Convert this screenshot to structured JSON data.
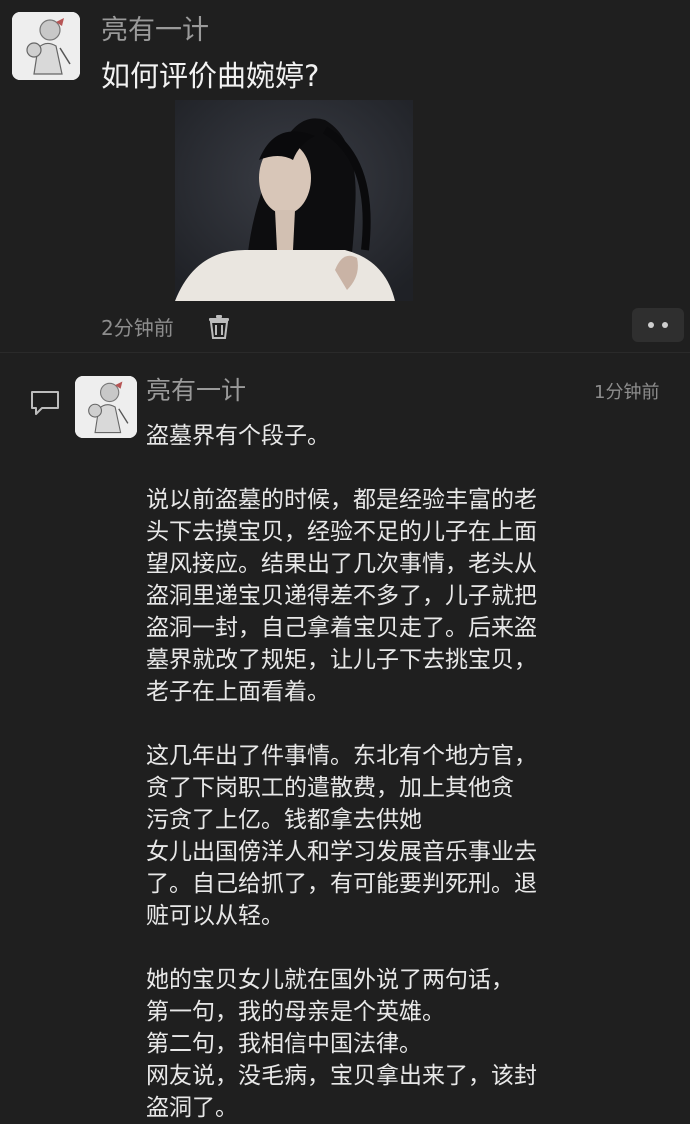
{
  "post": {
    "author": "亮有一计",
    "title": "如何评价曲婉婷?",
    "time": "2分钟前"
  },
  "comment": {
    "author": "亮有一计",
    "time": "1分钟前",
    "lines": [
      "盗墓界有个段子。",
      "",
      "说以前盗墓的时候，都是经验丰富的老",
      "头下去摸宝贝，经验不足的儿子在上面",
      "望风接应。结果出了几次事情，老头从",
      "盗洞里递宝贝递得差不多了，儿子就把",
      "盗洞一封，自己拿着宝贝走了。后来盗",
      "墓界就改了规矩，让儿子下去挑宝贝，",
      "老子在上面看着。",
      "",
      "这几年出了件事情。东北有个地方官，",
      "贪了下岗职工的遣散费，加上其他贪",
      "污贪了上亿。钱都拿去供她",
      "女儿出国傍洋人和学习发展音乐事业去",
      "了。自己给抓了，有可能要判死刑。退",
      "赃可以从轻。",
      "",
      "她的宝贝女儿就在国外说了两句话，",
      "第一句，我的母亲是个英雄。",
      "第二句，我相信中国法律。",
      "网友说，没毛病，宝贝拿出来了，该封",
      "盗洞了。"
    ]
  },
  "icons": {
    "trash": "trash-icon",
    "more": "more-icon",
    "comment": "comment-icon",
    "avatar": "avatar-illustration"
  },
  "colors": {
    "background": "#1f1f1f",
    "text_primary": "#e8e8e8",
    "text_secondary": "#9a9a9a"
  }
}
